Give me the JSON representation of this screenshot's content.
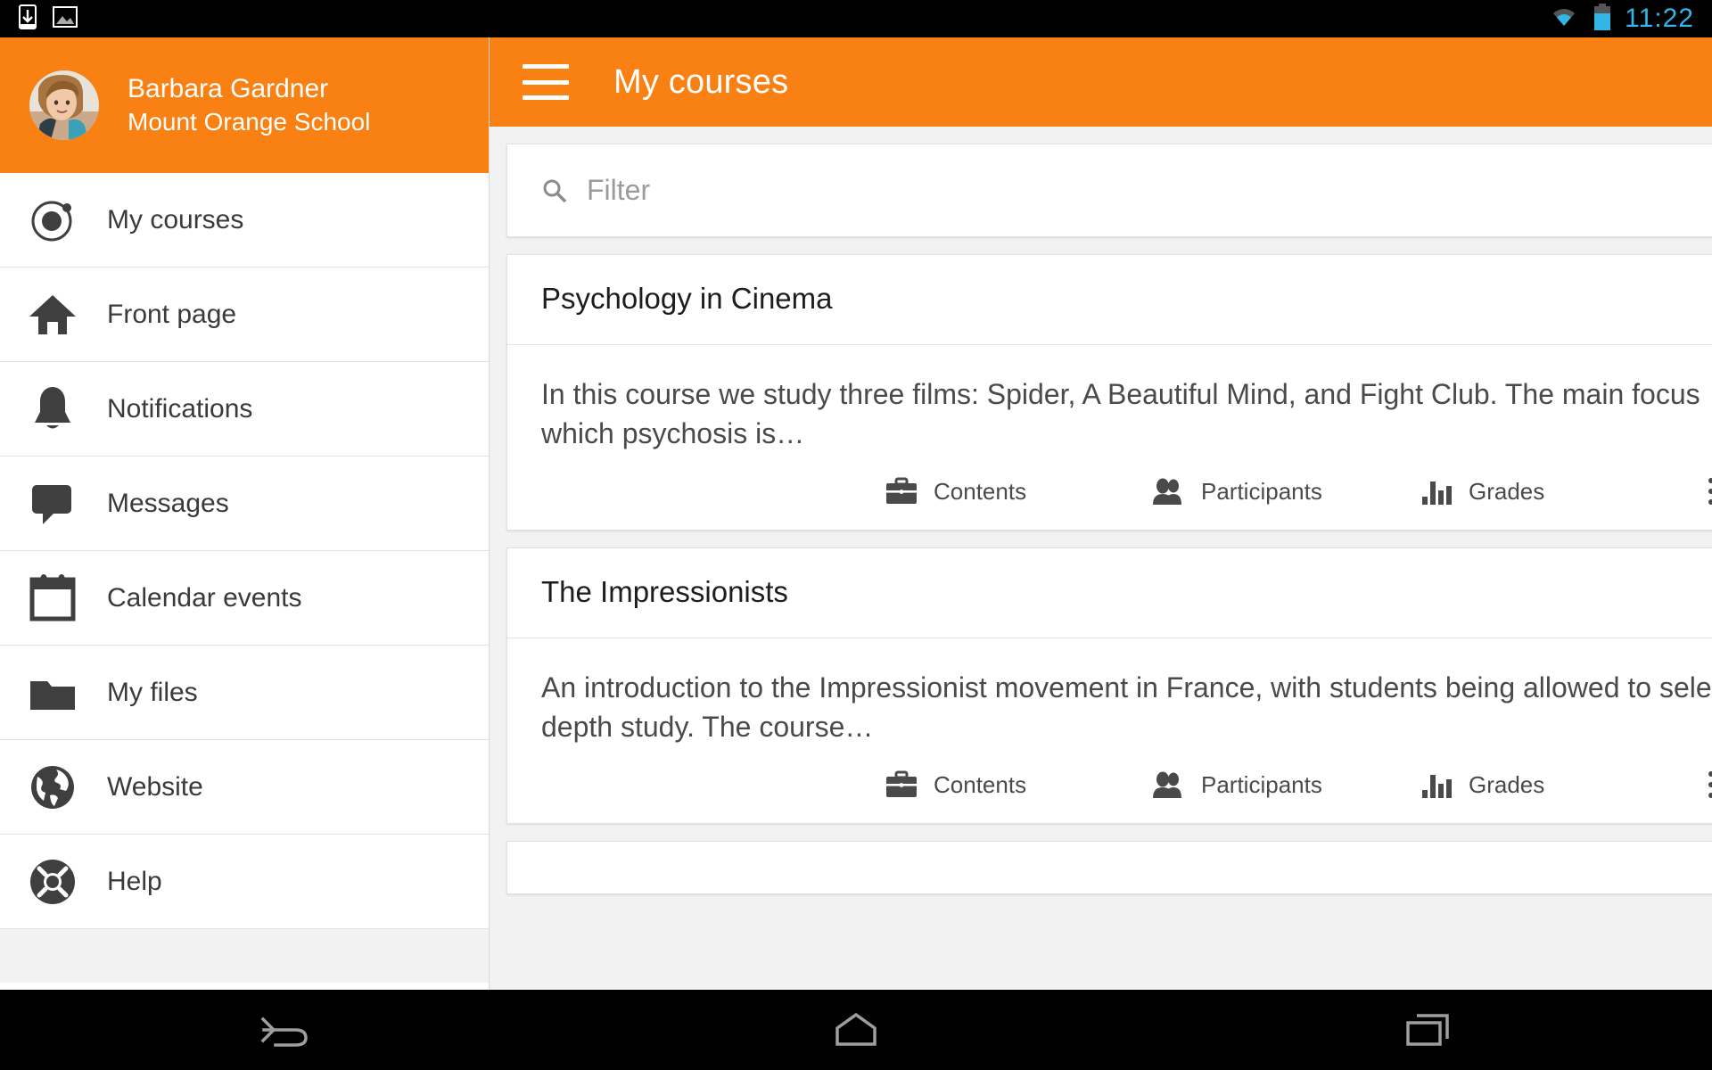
{
  "statusbar": {
    "time": "11:22",
    "icons": [
      "download-icon",
      "image-icon",
      "wifi-icon",
      "battery-icon"
    ]
  },
  "sidebar": {
    "user": {
      "name": "Barbara Gardner",
      "school": "Mount Orange School"
    },
    "items": [
      {
        "label": "My courses",
        "icon": "atom-orbit-icon"
      },
      {
        "label": "Front page",
        "icon": "home-icon"
      },
      {
        "label": "Notifications",
        "icon": "bell-icon"
      },
      {
        "label": "Messages",
        "icon": "chat-bubble-icon"
      },
      {
        "label": "Calendar events",
        "icon": "calendar-icon"
      },
      {
        "label": "My files",
        "icon": "folder-icon"
      },
      {
        "label": "Website",
        "icon": "globe-icon"
      },
      {
        "label": "Help",
        "icon": "life-ring-icon"
      }
    ]
  },
  "topbar": {
    "title": "My courses",
    "menu_icon": "hamburger-icon"
  },
  "search": {
    "placeholder": "Filter",
    "value": "",
    "icon": "search-icon"
  },
  "courses": [
    {
      "title": "Psychology in Cinema",
      "description": "In this course we study three films: Spider, A Beautiful Mind, and Fight Club. The main focus\nwhich psychosis is…",
      "actions": [
        {
          "label": "Contents",
          "icon": "briefcase-icon"
        },
        {
          "label": "Participants",
          "icon": "people-icon"
        },
        {
          "label": "Grades",
          "icon": "bar-chart-icon"
        },
        {
          "label": "",
          "icon": "more-vertical-icon"
        }
      ]
    },
    {
      "title": "The Impressionists",
      "description": "An introduction to the Impressionist movement in France, with students being allowed to sele\ndepth study. The course…",
      "actions": [
        {
          "label": "Contents",
          "icon": "briefcase-icon"
        },
        {
          "label": "Participants",
          "icon": "people-icon"
        },
        {
          "label": "Grades",
          "icon": "bar-chart-icon"
        },
        {
          "label": "",
          "icon": "more-vertical-icon"
        }
      ]
    }
  ],
  "navbar": {
    "buttons": [
      {
        "name": "back-icon"
      },
      {
        "name": "home-icon"
      },
      {
        "name": "recents-icon"
      }
    ]
  },
  "colors": {
    "accent": "#f98012",
    "status_text": "#33b5e5",
    "page_bg": "#f2f2f2"
  }
}
